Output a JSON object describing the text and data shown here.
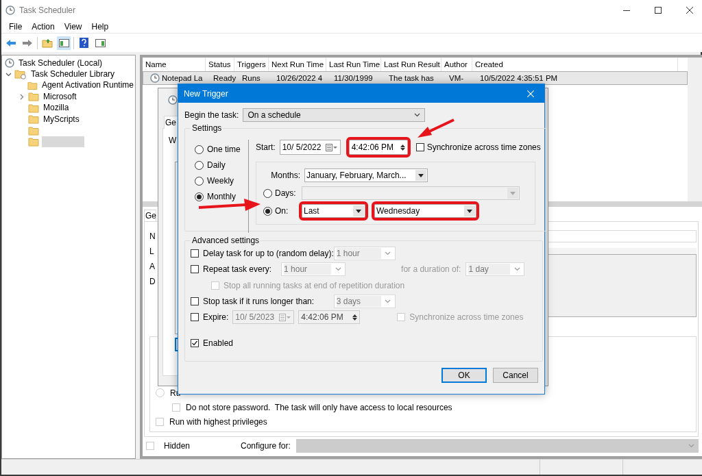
{
  "window": {
    "title": "Task Scheduler"
  },
  "menu": [
    {
      "label": "File"
    },
    {
      "label": "Action"
    },
    {
      "label": "View"
    },
    {
      "label": "Help"
    }
  ],
  "tree": {
    "label": "Task Scheduler (Local)",
    "children": [
      {
        "label": "Task Scheduler Library",
        "expanded": true,
        "children": [
          {
            "label": "Agent Activation Runtime",
            "expandable": false,
            "selected": false
          },
          {
            "label": "Microsoft",
            "expandable": true,
            "selected": false
          },
          {
            "label": "Mozilla",
            "expandable": false,
            "selected": false
          },
          {
            "label": "MyScripts",
            "expandable": false,
            "selected": false
          },
          {
            "expandable": false,
            "selected": false
          },
          {
            "expandable": false,
            "selected": true
          }
        ]
      }
    ]
  },
  "task_table": {
    "columns": [
      "Name",
      "Status",
      "Triggers",
      "Next Run Time",
      "Last Run Time",
      "Last Run Result",
      "Author",
      "Created"
    ],
    "rows": [
      {
        "cells": [
          "Notepad La",
          "Ready",
          "Runs",
          "10/26/2022 4",
          "11/30/1999",
          "The task has",
          "VM-",
          "10/5/2022 4:35:51 PM"
        ],
        "selected": true
      }
    ]
  },
  "properties_pane": {
    "tab": "Ge",
    "labels": [
      "N",
      "L",
      "A",
      "D"
    ],
    "run_option": {
      "label": "Ru",
      "selected": false
    },
    "options": [
      {
        "kind": "sub",
        "label": "Do not store password.  The task will only have access to local resources",
        "checked": false
      },
      {
        "kind": "check",
        "label": "Run with highest privileges",
        "checked": false
      }
    ],
    "hidden": {
      "label": "Hidden",
      "checked": false
    },
    "configure_label": "Configure for:"
  },
  "task_dialog": {
    "tab": "Ge",
    "label": "W"
  },
  "trigger_dialog": {
    "title": "New Trigger",
    "begin_label": "Begin the task:",
    "begin_value": "On a schedule",
    "settings_label": "Settings",
    "schedule_options": [
      {
        "label": "One time",
        "selected": false
      },
      {
        "label": "Daily",
        "selected": false
      },
      {
        "label": "Weekly",
        "selected": false
      },
      {
        "label": "Monthly",
        "selected": true
      }
    ],
    "start_label": "Start:",
    "start_date": "10/ 5/2022",
    "start_time": "4:42:06 PM",
    "start_time_highlighted": true,
    "sync": {
      "label": "Synchronize across time zones",
      "checked": false
    },
    "months_label": "Months:",
    "months_value": "January, February, March...",
    "days": {
      "label": "Days:",
      "selected": false
    },
    "on": {
      "label": "On:",
      "selected": true,
      "week": "Last",
      "week_highlighted": true,
      "day": "Wednesday",
      "day_highlighted": true
    },
    "advanced_label": "Advanced settings",
    "advanced": [
      {
        "kind": "dropdown",
        "label": "Delay task for up to (random delay):",
        "checked": false,
        "value": "1 hour"
      },
      {
        "kind": "repeat",
        "label": "Repeat task every:",
        "checked": false,
        "value": "1 hour",
        "duration_label": "for a duration of:",
        "duration_value": "1 day"
      },
      {
        "kind": "sub",
        "label": "Stop all running tasks at end of repetition duration",
        "checked": false,
        "disabled": true
      },
      {
        "kind": "dropdown",
        "label": "Stop task if it runs longer than:",
        "checked": false,
        "value": "3 days"
      },
      {
        "kind": "expire",
        "label": "Expire:",
        "checked": false,
        "date": "10/ 5/2023",
        "time": "4:42:06 PM",
        "sync_label": "Synchronize across time zones",
        "sync_checked": false
      },
      {
        "kind": "check",
        "label": "Enabled",
        "checked": true
      }
    ],
    "buttons": [
      {
        "label": "OK",
        "default": true
      },
      {
        "label": "Cancel",
        "default": false
      }
    ]
  }
}
